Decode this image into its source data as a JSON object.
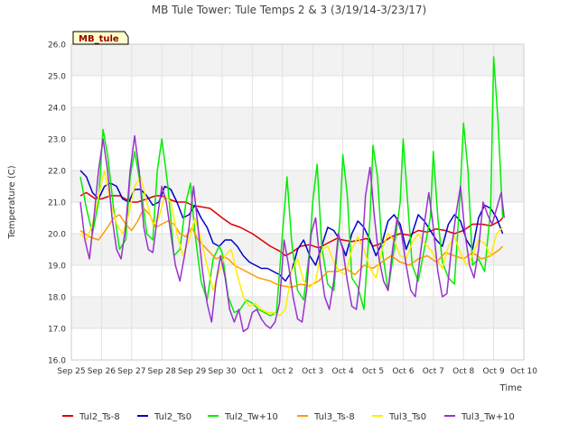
{
  "chart_data": {
    "type": "line",
    "title": "MB Tule Tower: Tule Temps 2 & 3 (3/19/14-3/23/17)",
    "xlabel": "Time",
    "ylabel": "Temperature (C)",
    "annotation": "MB_tule",
    "x_range_days": [
      0,
      15
    ],
    "ylim": [
      16.0,
      26.0
    ],
    "x_tick_labels": [
      "Sep 25",
      "Sep 26",
      "Sep 27",
      "Sep 28",
      "Sep 29",
      "Sep 30",
      "Oct 1",
      "Oct 2",
      "Oct 3",
      "Oct 4",
      "Oct 5",
      "Oct 6",
      "Oct 7",
      "Oct 8",
      "Oct 9",
      "Oct 10"
    ],
    "y_ticks": [
      16.0,
      17.0,
      18.0,
      19.0,
      20.0,
      21.0,
      22.0,
      23.0,
      24.0,
      25.0,
      26.0
    ],
    "grid": true,
    "legend_position": "bottom",
    "series": [
      {
        "name": "Tul2_Ts-8",
        "color": "#dd0000",
        "x": [
          0.3,
          0.5,
          0.8,
          1.0,
          1.3,
          1.6,
          1.8,
          2.0,
          2.2,
          2.5,
          2.8,
          3.0,
          3.2,
          3.5,
          3.8,
          4.0,
          4.3,
          4.6,
          5.0,
          5.3,
          5.6,
          6.0,
          6.3,
          6.6,
          6.9,
          7.1,
          7.3,
          7.6,
          7.9,
          8.2,
          8.5,
          8.8,
          9.0,
          9.3,
          9.6,
          9.8,
          10.0,
          10.3,
          10.6,
          10.9,
          11.2,
          11.5,
          11.8,
          12.1,
          12.4,
          12.7,
          13.0,
          13.3,
          13.6,
          13.9,
          14.2,
          14.3
        ],
        "y": [
          21.2,
          21.3,
          21.1,
          21.1,
          21.2,
          21.2,
          21.1,
          21.0,
          21.0,
          21.1,
          21.2,
          21.2,
          21.1,
          21.0,
          21.0,
          20.9,
          20.85,
          20.8,
          20.5,
          20.3,
          20.2,
          20.0,
          19.8,
          19.6,
          19.45,
          19.3,
          19.4,
          19.6,
          19.65,
          19.55,
          19.7,
          19.85,
          19.8,
          19.75,
          19.8,
          19.85,
          19.6,
          19.7,
          19.9,
          20.0,
          19.95,
          20.1,
          20.05,
          20.15,
          20.1,
          20.0,
          20.1,
          20.3,
          20.3,
          20.25,
          20.4,
          20.5
        ]
      },
      {
        "name": "Tul2_Ts0",
        "color": "#0000cc",
        "x": [
          0.3,
          0.5,
          0.7,
          0.9,
          1.1,
          1.3,
          1.5,
          1.7,
          1.9,
          2.1,
          2.3,
          2.5,
          2.7,
          2.9,
          3.1,
          3.3,
          3.5,
          3.7,
          3.9,
          4.1,
          4.3,
          4.5,
          4.7,
          4.9,
          5.1,
          5.3,
          5.5,
          5.7,
          5.9,
          6.1,
          6.3,
          6.5,
          6.7,
          6.9,
          7.1,
          7.3,
          7.5,
          7.7,
          7.9,
          8.1,
          8.3,
          8.5,
          8.7,
          8.9,
          9.1,
          9.3,
          9.5,
          9.7,
          9.9,
          10.1,
          10.3,
          10.5,
          10.7,
          10.9,
          11.1,
          11.3,
          11.5,
          11.7,
          11.9,
          12.1,
          12.3,
          12.5,
          12.7,
          12.9,
          13.1,
          13.3,
          13.5,
          13.7,
          13.9,
          14.1,
          14.3
        ],
        "y": [
          22.0,
          21.8,
          21.3,
          21.1,
          21.5,
          21.6,
          21.5,
          21.1,
          21.0,
          21.4,
          21.4,
          21.2,
          20.9,
          21.0,
          21.5,
          21.4,
          21.0,
          20.5,
          20.6,
          20.9,
          20.5,
          20.2,
          19.7,
          19.6,
          19.8,
          19.8,
          19.6,
          19.3,
          19.1,
          19.0,
          18.9,
          18.9,
          18.8,
          18.7,
          18.5,
          18.8,
          19.5,
          19.8,
          19.3,
          19.0,
          19.6,
          20.2,
          20.1,
          19.8,
          19.3,
          20.0,
          20.4,
          20.2,
          19.8,
          19.3,
          19.7,
          20.4,
          20.6,
          20.3,
          19.5,
          20.0,
          20.6,
          20.4,
          20.1,
          19.8,
          19.6,
          20.3,
          20.6,
          20.4,
          19.8,
          19.5,
          20.5,
          20.9,
          20.8,
          20.5,
          20.0
        ],
        "y2": [
          21.5,
          21.9
        ]
      },
      {
        "name": "Tul2_Tw+10",
        "color": "#00ee00",
        "x": [
          0.3,
          0.5,
          0.7,
          0.9,
          1.05,
          1.2,
          1.4,
          1.6,
          1.8,
          1.95,
          2.1,
          2.3,
          2.5,
          2.7,
          2.85,
          3.0,
          3.2,
          3.4,
          3.6,
          3.8,
          3.95,
          4.1,
          4.3,
          4.5,
          4.7,
          4.9,
          5.0,
          5.2,
          5.4,
          5.6,
          5.8,
          6.0,
          6.2,
          6.4,
          6.6,
          6.8,
          7.0,
          7.15,
          7.3,
          7.5,
          7.7,
          7.9,
          8.0,
          8.15,
          8.3,
          8.5,
          8.7,
          8.9,
          9.0,
          9.15,
          9.3,
          9.5,
          9.7,
          9.9,
          10.0,
          10.15,
          10.3,
          10.5,
          10.7,
          10.9,
          11.0,
          11.15,
          11.3,
          11.5,
          11.7,
          11.9,
          12.0,
          12.15,
          12.3,
          12.5,
          12.7,
          12.9,
          13.0,
          13.15,
          13.3,
          13.5,
          13.7,
          13.9,
          14.0,
          14.15,
          14.3
        ],
        "y": [
          21.8,
          20.8,
          20.0,
          21.0,
          23.3,
          22.5,
          20.8,
          19.5,
          19.8,
          21.8,
          22.6,
          21.5,
          20.0,
          19.8,
          22.0,
          23.0,
          21.5,
          19.3,
          19.5,
          21.0,
          21.6,
          20.0,
          18.5,
          17.9,
          19.2,
          19.6,
          19.4,
          18.0,
          17.5,
          17.6,
          17.9,
          17.8,
          17.6,
          17.5,
          17.4,
          17.5,
          20.0,
          21.8,
          19.8,
          18.2,
          17.9,
          19.5,
          21.0,
          22.2,
          19.6,
          18.4,
          18.2,
          20.4,
          22.5,
          21.2,
          18.6,
          18.3,
          17.6,
          20.5,
          22.8,
          21.8,
          19.5,
          18.2,
          19.5,
          21.0,
          23.0,
          21.0,
          19.0,
          18.5,
          19.5,
          20.5,
          22.6,
          20.5,
          19.1,
          18.6,
          18.4,
          21.5,
          23.5,
          22.0,
          19.0,
          19.2,
          18.8,
          20.8,
          25.6,
          23.5,
          20.5
        ]
      },
      {
        "name": "Tul3_Ts-8",
        "color": "#ff9900",
        "x": [
          0.3,
          0.6,
          0.9,
          1.2,
          1.4,
          1.6,
          1.8,
          2.0,
          2.2,
          2.4,
          2.6,
          2.8,
          3.0,
          3.2,
          3.4,
          3.6,
          3.8,
          4.0,
          4.2,
          4.4,
          4.6,
          4.8,
          5.0,
          5.2,
          5.4,
          5.6,
          5.8,
          6.0,
          6.2,
          6.4,
          6.6,
          6.8,
          7.0,
          7.3,
          7.6,
          7.9,
          8.2,
          8.5,
          8.8,
          9.1,
          9.4,
          9.7,
          10.0,
          10.3,
          10.6,
          10.9,
          11.2,
          11.5,
          11.8,
          12.1,
          12.4,
          12.7,
          13.0,
          13.3,
          13.6,
          13.9,
          14.2,
          14.3
        ],
        "y": [
          20.1,
          19.9,
          19.8,
          20.2,
          20.5,
          20.6,
          20.3,
          20.1,
          20.4,
          20.8,
          20.6,
          20.2,
          20.3,
          20.4,
          20.3,
          20.0,
          19.9,
          20.2,
          19.8,
          19.6,
          19.4,
          19.2,
          19.3,
          19.2,
          19.0,
          18.9,
          18.8,
          18.7,
          18.6,
          18.55,
          18.5,
          18.4,
          18.35,
          18.3,
          18.4,
          18.35,
          18.5,
          18.8,
          18.8,
          18.9,
          18.7,
          19.0,
          18.9,
          19.1,
          19.3,
          19.1,
          19.0,
          19.2,
          19.3,
          19.1,
          19.4,
          19.3,
          19.2,
          19.4,
          19.2,
          19.3,
          19.5,
          19.6
        ]
      },
      {
        "name": "Tul3_Ts0",
        "color": "#ffee00",
        "x": [
          0.3,
          0.5,
          0.7,
          0.9,
          1.1,
          1.3,
          1.5,
          1.7,
          1.9,
          2.1,
          2.3,
          2.5,
          2.7,
          2.9,
          3.1,
          3.3,
          3.5,
          3.7,
          3.9,
          4.1,
          4.3,
          4.5,
          4.7,
          4.9,
          5.1,
          5.3,
          5.5,
          5.7,
          5.9,
          6.1,
          6.3,
          6.5,
          6.7,
          6.9,
          7.1,
          7.3,
          7.5,
          7.7,
          7.9,
          8.1,
          8.3,
          8.5,
          8.7,
          8.9,
          9.1,
          9.3,
          9.5,
          9.7,
          9.9,
          10.1,
          10.3,
          10.5,
          10.7,
          10.9,
          11.1,
          11.3,
          11.5,
          11.7,
          11.9,
          12.1,
          12.3,
          12.5,
          12.7,
          12.9,
          13.1,
          13.3,
          13.5,
          13.7,
          13.9,
          14.1,
          14.3
        ],
        "y": [
          20.0,
          19.8,
          20.3,
          21.2,
          22.0,
          21.0,
          20.3,
          20.0,
          20.6,
          21.5,
          21.8,
          21.0,
          20.3,
          20.5,
          21.2,
          21.0,
          20.0,
          19.3,
          19.8,
          20.5,
          19.8,
          19.0,
          18.2,
          18.8,
          19.3,
          19.5,
          18.7,
          18.0,
          17.7,
          17.8,
          17.6,
          17.5,
          17.5,
          17.4,
          17.6,
          18.8,
          19.2,
          18.5,
          18.3,
          18.5,
          19.5,
          19.6,
          19.1,
          18.8,
          18.7,
          19.5,
          19.9,
          19.5,
          18.9,
          18.6,
          19.5,
          20.0,
          19.8,
          19.3,
          19.2,
          19.7,
          20.0,
          19.7,
          19.5,
          19.2,
          18.9,
          19.6,
          19.9,
          19.4,
          19.0,
          19.3,
          19.8,
          19.7,
          19.3,
          20.0,
          20.2
        ]
      },
      {
        "name": "Tul3_Tw+10",
        "color": "#9933cc",
        "x": [
          0.3,
          0.45,
          0.6,
          0.75,
          0.9,
          1.05,
          1.2,
          1.35,
          1.5,
          1.65,
          1.8,
          1.95,
          2.1,
          2.25,
          2.4,
          2.55,
          2.7,
          2.85,
          3.0,
          3.15,
          3.3,
          3.45,
          3.6,
          3.75,
          3.9,
          4.05,
          4.2,
          4.35,
          4.5,
          4.65,
          4.8,
          4.95,
          5.1,
          5.25,
          5.4,
          5.55,
          5.7,
          5.85,
          6.0,
          6.15,
          6.3,
          6.45,
          6.6,
          6.75,
          6.9,
          7.05,
          7.2,
          7.35,
          7.5,
          7.65,
          7.8,
          7.95,
          8.1,
          8.25,
          8.4,
          8.55,
          8.7,
          8.85,
          9.0,
          9.15,
          9.3,
          9.45,
          9.6,
          9.75,
          9.9,
          10.05,
          10.2,
          10.35,
          10.5,
          10.65,
          10.8,
          10.95,
          11.1,
          11.25,
          11.4,
          11.55,
          11.7,
          11.85,
          12.0,
          12.15,
          12.3,
          12.45,
          12.6,
          12.75,
          12.9,
          13.05,
          13.2,
          13.35,
          13.5,
          13.65,
          13.8,
          13.95,
          14.1,
          14.25,
          14.35
        ],
        "y": [
          21.0,
          19.8,
          19.2,
          20.5,
          22.0,
          23.0,
          22.0,
          20.5,
          19.5,
          19.2,
          20.2,
          22.0,
          23.1,
          22.0,
          20.2,
          19.5,
          19.4,
          20.5,
          21.5,
          21.0,
          20.0,
          19.0,
          18.5,
          19.3,
          20.2,
          21.5,
          20.2,
          18.8,
          17.8,
          17.2,
          18.5,
          19.3,
          18.6,
          17.6,
          17.2,
          17.6,
          16.9,
          17.0,
          17.5,
          17.6,
          17.3,
          17.1,
          17.0,
          17.2,
          17.8,
          19.8,
          19.0,
          18.0,
          17.3,
          17.2,
          18.2,
          20.0,
          20.5,
          19.0,
          18.0,
          17.6,
          18.5,
          20.0,
          19.5,
          18.5,
          17.7,
          17.6,
          18.8,
          21.2,
          22.1,
          20.5,
          19.2,
          18.5,
          18.2,
          19.5,
          20.5,
          20.0,
          19.0,
          18.2,
          18.0,
          19.2,
          20.3,
          21.3,
          20.2,
          18.8,
          18.0,
          18.1,
          19.5,
          20.6,
          21.5,
          20.0,
          19.0,
          18.6,
          19.5,
          21.0,
          20.6,
          20.3,
          20.8,
          21.3,
          20.5
        ]
      }
    ]
  }
}
